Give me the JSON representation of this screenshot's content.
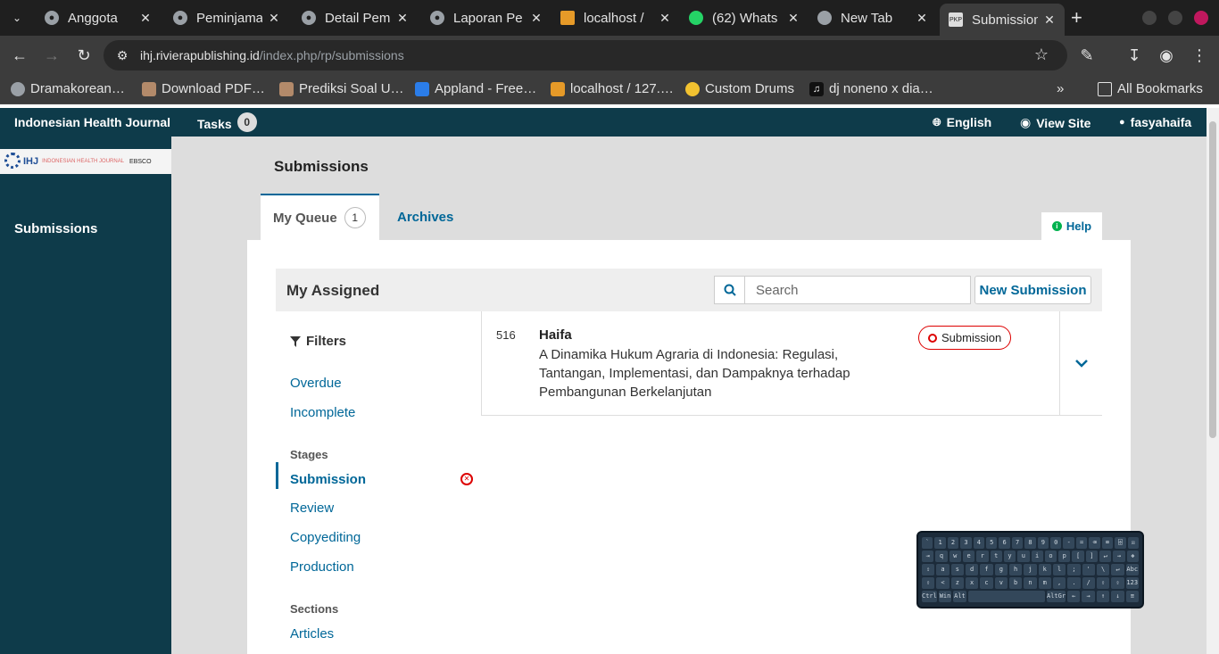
{
  "browser": {
    "tabs": [
      {
        "title": "Anggota",
        "icon": "globe-icon"
      },
      {
        "title": "Peminjama",
        "icon": "globe-icon"
      },
      {
        "title": "Detail Pem",
        "icon": "globe-icon"
      },
      {
        "title": "Laporan Pe",
        "icon": "globe-icon"
      },
      {
        "title": "localhost /",
        "icon": "phpmyadmin-icon"
      },
      {
        "title": "(62) Whats",
        "icon": "whatsapp-icon"
      },
      {
        "title": "New Tab",
        "icon": "chrome-icon"
      },
      {
        "title": "Submission",
        "icon": "pkp-icon"
      }
    ],
    "url_host": "ihj.rivierapublishing.id",
    "url_path": "/index.php/rp/submissions",
    "bookmarks": [
      {
        "label": "Dramakorean…"
      },
      {
        "label": "Download PDF…"
      },
      {
        "label": "Prediksi Soal U…"
      },
      {
        "label": "Appland - Free…"
      },
      {
        "label": "localhost / 127.…"
      },
      {
        "label": "Custom Drums"
      },
      {
        "label": "dj noneno x dia…"
      }
    ],
    "all_bookmarks": "All Bookmarks"
  },
  "header": {
    "journal": "Indonesian Health Journal",
    "tasks_label": "Tasks",
    "tasks_count": "0",
    "language": "English",
    "view_site": "View Site",
    "user": "fasyahaifa"
  },
  "sidebar": {
    "logo_text": "IHJ",
    "logo_sub": "INDONESIAN HEALTH JOURNAL",
    "logo_partner": "EBSCO",
    "items": [
      {
        "label": "Submissions"
      }
    ]
  },
  "page": {
    "title": "Submissions",
    "tabs": [
      {
        "label": "My Queue",
        "count": "1"
      },
      {
        "label": "Archives"
      }
    ],
    "help": "Help"
  },
  "list": {
    "title": "My Assigned",
    "search_placeholder": "Search",
    "new_submission": "New Submission"
  },
  "filters": {
    "title": "Filters",
    "quick": [
      "Overdue",
      "Incomplete"
    ],
    "stages_heading": "Stages",
    "stages": [
      "Submission",
      "Review",
      "Copyediting",
      "Production"
    ],
    "sections_heading": "Sections",
    "sections": [
      "Articles"
    ]
  },
  "submissions": [
    {
      "id": "516",
      "author": "Haifa",
      "title": "A Dinamika Hukum Agraria di Indonesia: Regulasi, Tantangan, Implementasi, dan Dampaknya terhadap Pembangunan Berkelanjutan",
      "stage": "Submission"
    }
  ],
  "keyboard": {
    "rows": [
      [
        "`",
        "1",
        "2",
        "3",
        "4",
        "5",
        "6",
        "7",
        "8",
        "9",
        "0",
        "-",
        "=",
        "⌫",
        "⌧",
        "⌹",
        "☒"
      ],
      [
        "⇥",
        "q",
        "w",
        "e",
        "r",
        "t",
        "y",
        "u",
        "i",
        "o",
        "p",
        "[",
        "]",
        "↵",
        "→",
        "❖"
      ],
      [
        "⇪",
        "a",
        "s",
        "d",
        "f",
        "g",
        "h",
        "j",
        "k",
        "l",
        ";",
        "'",
        "\\",
        "↵",
        "Abc"
      ],
      [
        "⇧",
        "<",
        "z",
        "x",
        "c",
        "v",
        "b",
        "n",
        "m",
        ",",
        ".",
        "/",
        "⇧",
        "⇧",
        "123"
      ],
      [
        "Ctrl",
        "Win",
        "Alt",
        "",
        "AltGr",
        "←",
        "→",
        "↑",
        "↓",
        "≡"
      ]
    ]
  },
  "colors": {
    "ojs_dark": "#0e3b4a",
    "ojs_link": "#006798",
    "stage_red": "#dd0000"
  }
}
